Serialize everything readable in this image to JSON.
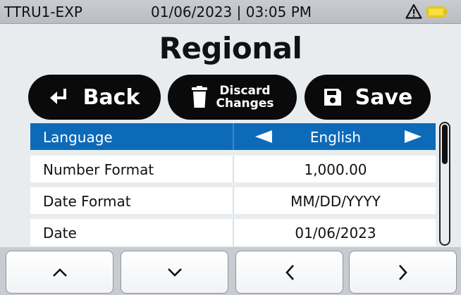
{
  "status_bar": {
    "device_name": "TTRU1-EXP",
    "datetime": "01/06/2023 | 03:05 PM",
    "icons": [
      "warning-icon",
      "battery-icon"
    ],
    "battery_color": "#f2d31b"
  },
  "page": {
    "title": "Regional"
  },
  "actions": {
    "back_label": "Back",
    "discard_label": "Discard\nChanges",
    "save_label": "Save"
  },
  "settings": [
    {
      "label": "Language",
      "value": "English",
      "selected": true
    },
    {
      "label": "Number Format",
      "value": "1,000.00",
      "selected": false
    },
    {
      "label": "Date Format",
      "value": "MM/DD/YYYY",
      "selected": false
    },
    {
      "label": "Date",
      "value": "01/06/2023",
      "selected": false
    }
  ],
  "nav_buttons": [
    "chevron-up-icon",
    "chevron-down-icon",
    "chevron-left-icon",
    "chevron-right-icon"
  ],
  "colors": {
    "selected_row": "#0d6ab8",
    "button_bg": "#0a0a0a"
  }
}
